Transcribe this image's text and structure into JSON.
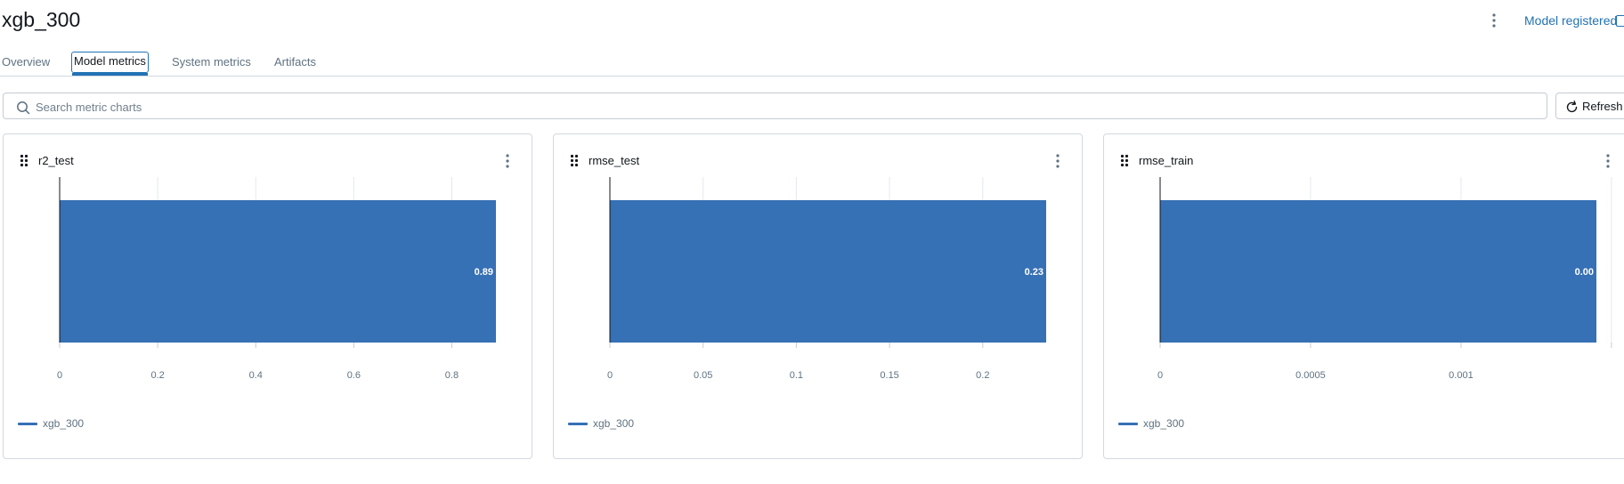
{
  "header": {
    "title": "xgb_300",
    "model_registered": "Model registered"
  },
  "tabs": [
    {
      "label": "Overview",
      "active": false
    },
    {
      "label": "Model metrics",
      "active": true
    },
    {
      "label": "System metrics",
      "active": false
    },
    {
      "label": "Artifacts",
      "active": false
    }
  ],
  "search": {
    "placeholder": "Search metric charts",
    "value": ""
  },
  "refresh_label": "Refresh",
  "colors": {
    "bar": "#3670b5",
    "accent": "#2272b4"
  },
  "chart_data": [
    {
      "type": "bar",
      "title": "r2_test",
      "orientation": "horizontal",
      "series": [
        {
          "name": "xgb_300",
          "values": [
            0.89
          ]
        }
      ],
      "bar_label": "0.89",
      "xlim": [
        0,
        0.89
      ],
      "ticks": [
        0,
        0.2,
        0.4,
        0.6,
        0.8
      ],
      "tick_labels": [
        "0",
        "0.2",
        "0.4",
        "0.6",
        "0.8"
      ],
      "grid": true,
      "legend": "bottom-left"
    },
    {
      "type": "bar",
      "title": "rmse_test",
      "orientation": "horizontal",
      "series": [
        {
          "name": "xgb_300",
          "values": [
            0.234
          ]
        }
      ],
      "bar_label": "0.23",
      "xlim": [
        0,
        0.234
      ],
      "ticks": [
        0,
        0.05,
        0.1,
        0.15,
        0.2
      ],
      "tick_labels": [
        "0",
        "0.05",
        "0.1",
        "0.15",
        "0.2"
      ],
      "grid": true,
      "legend": "bottom-left"
    },
    {
      "type": "bar",
      "title": "rmse_train",
      "orientation": "horizontal",
      "series": [
        {
          "name": "xgb_300",
          "values": [
            0.00145
          ]
        }
      ],
      "bar_label": "0.00",
      "xlim": [
        0,
        0.00145
      ],
      "ticks": [
        0,
        0.0005,
        0.001,
        0.0015
      ],
      "tick_labels": [
        "0",
        "0.0005",
        "0.001",
        ""
      ],
      "grid": true,
      "legend": "bottom-left"
    }
  ]
}
